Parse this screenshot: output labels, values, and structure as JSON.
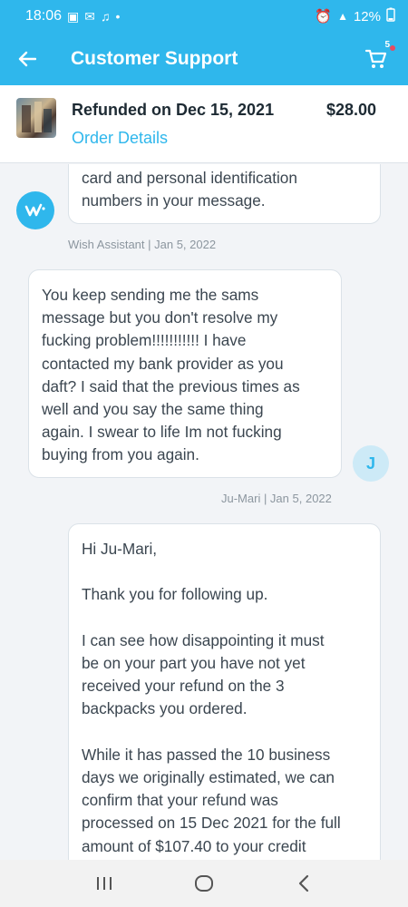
{
  "status_bar": {
    "time": "18:06",
    "battery": "12%"
  },
  "app_bar": {
    "title": "Customer Support",
    "cart_count": "5"
  },
  "order": {
    "status": "Refunded on Dec 15, 2021",
    "price": "$28.00",
    "details_link": "Order Details"
  },
  "messages": [
    {
      "sender": "Wish Assistant",
      "avatar_letter": "w",
      "text": "card and personal identification\nnumbers in your message.",
      "meta": "Wish Assistant | Jan 5, 2022"
    },
    {
      "sender": "Ju-Mari",
      "avatar_letter": "J",
      "text": "You keep sending me the sams\nmessage but you don't resolve my\nfucking problem!!!!!!!!!!! I have\ncontacted my bank provider as you\ndaft? I said that the previous times as\nwell and you say the same thing\nagain. I swear to life Im not fucking\nbuying from you again.",
      "meta": "Ju-Mari | Jan 5, 2022"
    },
    {
      "sender": "Wish Assistant",
      "text": "Hi Ju-Mari,\n\nThank you for following up.\n\nI can see how disappointing it must\nbe on your part you have not yet\nreceived your refund on the 3\nbackpacks you ordered.\n\nWhile it has passed the 10 business\ndays we originally estimated, we can\nconfirm that your refund was\nprocessed on 15 Dec 2021 for the full\namount of $107.40 to your credit"
    }
  ],
  "colors": {
    "brand": "#2fb7ec",
    "user_avatar_bg": "#cdeaf7"
  }
}
